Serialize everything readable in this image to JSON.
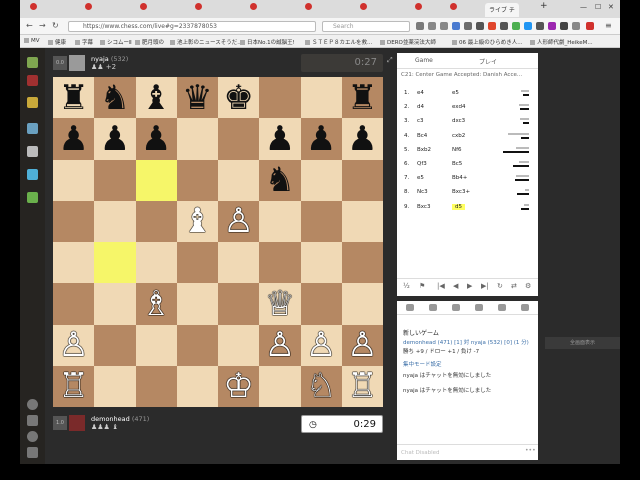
{
  "browser": {
    "active_tab": "ライブ チ",
    "url": "https://www.chess.com/live#g=2337878053",
    "search_placeholder": "Search",
    "bookmarks": [
      "MV",
      "健康",
      "字幕",
      "シコムーⅡ",
      "肥月頭の",
      "池上彰のニュースそうだ...",
      "日本No.1の誠脳王!",
      "ＳＴＥＰ８カエルを救...",
      "DERO並薬浣法大師",
      "06 最上級のひらめき人...",
      "人形師代劇_HeikeM..."
    ]
  },
  "top_player": {
    "rating_box": "0.0",
    "name": "nyaja",
    "rating": "(532)",
    "flag": "de",
    "captured": "♟♟ +2",
    "clock": "0:27"
  },
  "bottom_player": {
    "rating_box": "1.0",
    "name": "demonhead",
    "rating": "(471)",
    "flag": "gb",
    "captured": "♟♟♟ ♝",
    "clock": "0:29"
  },
  "board": {
    "light": "#f0d9b5",
    "dark": "#b58863",
    "highlight": "#f6f669",
    "highlights": [
      "c6",
      "b4"
    ],
    "pieces": [
      {
        "sq": "a8",
        "p": "♜",
        "c": "b"
      },
      {
        "sq": "b8",
        "p": "♞",
        "c": "b"
      },
      {
        "sq": "c8",
        "p": "♝",
        "c": "b"
      },
      {
        "sq": "d8",
        "p": "♛",
        "c": "b"
      },
      {
        "sq": "e8",
        "p": "♚",
        "c": "b"
      },
      {
        "sq": "h8",
        "p": "♜",
        "c": "b"
      },
      {
        "sq": "a7",
        "p": "♟",
        "c": "b"
      },
      {
        "sq": "b7",
        "p": "♟",
        "c": "b"
      },
      {
        "sq": "c7",
        "p": "♟",
        "c": "b"
      },
      {
        "sq": "f7",
        "p": "♟",
        "c": "b"
      },
      {
        "sq": "g7",
        "p": "♟",
        "c": "b"
      },
      {
        "sq": "h7",
        "p": "♟",
        "c": "b"
      },
      {
        "sq": "f6",
        "p": "♞",
        "c": "b"
      },
      {
        "sq": "d5",
        "p": "♝",
        "c": "w"
      },
      {
        "sq": "e5",
        "p": "♙",
        "c": "w"
      },
      {
        "sq": "c3",
        "p": "♗",
        "c": "w"
      },
      {
        "sq": "f3",
        "p": "♕",
        "c": "w"
      },
      {
        "sq": "a2",
        "p": "♙",
        "c": "w"
      },
      {
        "sq": "f2",
        "p": "♙",
        "c": "w"
      },
      {
        "sq": "g2",
        "p": "♙",
        "c": "w"
      },
      {
        "sq": "h2",
        "p": "♙",
        "c": "w"
      },
      {
        "sq": "a1",
        "p": "♖",
        "c": "w"
      },
      {
        "sq": "e1",
        "p": "♔",
        "c": "w"
      },
      {
        "sq": "g1",
        "p": "♘",
        "c": "w"
      },
      {
        "sq": "h1",
        "p": "♖",
        "c": "w"
      }
    ]
  },
  "panel": {
    "tab_game": "Game",
    "tab_play": "プレイ",
    "opening": "C21: Center Game Accepted: Danish Acce...",
    "moves": [
      {
        "n": "1.",
        "w": "e4",
        "b": "e5",
        "gray": 0.3,
        "black": 0.25
      },
      {
        "n": "2.",
        "w": "d4",
        "b": "exd4",
        "gray": 0.4,
        "black": 0.35
      },
      {
        "n": "3.",
        "w": "c3",
        "b": "dxc3",
        "gray": 0.35,
        "black": 0.25
      },
      {
        "n": "4.",
        "w": "Bc4",
        "b": "cxb2",
        "gray": 0.8,
        "black": 0.3
      },
      {
        "n": "5.",
        "w": "Bxb2",
        "b": "Nf6",
        "gray": 0.5,
        "black": 1.0
      },
      {
        "n": "6.",
        "w": "Qf3",
        "b": "Bc5",
        "gray": 0.4,
        "black": 0.6
      },
      {
        "n": "7.",
        "w": "e5",
        "b": "Bb4+",
        "gray": 0.5,
        "black": 0.55
      },
      {
        "n": "8.",
        "w": "Nc3",
        "b": "Bxc3+",
        "gray": 0.15,
        "black": 0.45
      },
      {
        "n": "9.",
        "w": "Bxc3",
        "b": "d5",
        "gray": 0.2,
        "black": 0.3
      }
    ]
  },
  "chat": {
    "title": "新しいゲーム",
    "line1": "demonhead (471) [1] 対 nyaja (532) [0] (1 分)",
    "line2": "勝ち +9 / ドロー +1 / 負け -7",
    "link": "集中モード設定",
    "msg1": "nyaja はチャットを無効にしました",
    "msg2": "nyaja はチャットを無効にしました",
    "input_placeholder": "Chat Disabled",
    "side_button": "全画面表示"
  }
}
